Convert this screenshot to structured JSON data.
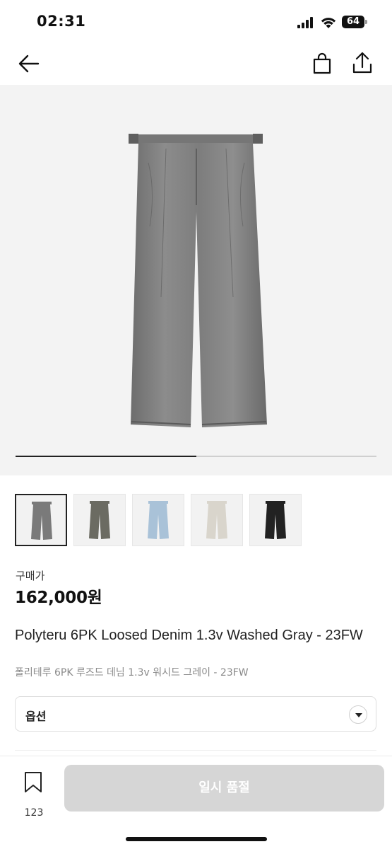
{
  "status": {
    "time": "02:31",
    "battery": "64"
  },
  "gallery": {
    "current_image": 1,
    "total_images": 2
  },
  "thumbnails": [
    {
      "name": "thumb-washed-gray",
      "color": "#7a7a7a"
    },
    {
      "name": "thumb-olive",
      "color": "#6b6b62"
    },
    {
      "name": "thumb-light-blue",
      "color": "#a9c2d8"
    },
    {
      "name": "thumb-ecru",
      "color": "#d9d5cc"
    },
    {
      "name": "thumb-black",
      "color": "#222222"
    }
  ],
  "product": {
    "price_label": "구매가",
    "price": "162,000원",
    "title_en": "Polyteru 6PK Loosed Denim 1.3v Washed Gray - 23FW",
    "title_ko": "폴리테루 6PK 루즈드 데님 1.3v 워시드 그레이 - 23FW"
  },
  "option": {
    "label": "옵션"
  },
  "bottom": {
    "wishlist_count": "123",
    "buy_label": "일시 품절",
    "buy_color": "#d6d6d6"
  },
  "icons": [
    "back-arrow-icon",
    "shopping-bag-icon",
    "share-icon",
    "chevron-down-icon",
    "bookmark-icon"
  ]
}
